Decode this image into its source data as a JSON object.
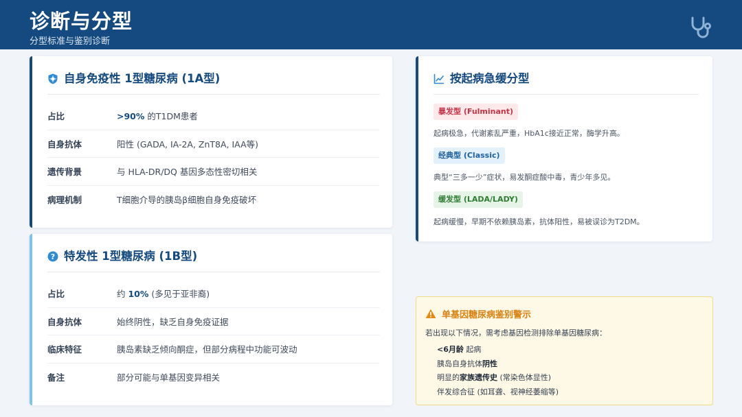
{
  "header": {
    "title": "诊断与分型",
    "subtitle": "分型标准与鉴别诊断"
  },
  "type1a": {
    "title": "自身免疫性 1型糖尿病 (1A型)",
    "rows": [
      {
        "key": "占比",
        "value_strong": ">90%",
        "value_rest": " 的T1DM患者"
      },
      {
        "key": "自身抗体",
        "value": "阳性 (GADA, IA-2A, ZnT8A, IAA等)"
      },
      {
        "key": "遗传背景",
        "value": "与 HLA-DR/DQ 基因多态性密切相关"
      },
      {
        "key": "病理机制",
        "value": "T细胞介导的胰岛β细胞自身免疫破坏"
      }
    ]
  },
  "type1b": {
    "title": "特发性 1型糖尿病 (1B型)",
    "rows": [
      {
        "key": "占比",
        "value_pre": "约 ",
        "value_strong": "10%",
        "value_rest": " (多见于亚非裔)"
      },
      {
        "key": "自身抗体",
        "value": "始终阴性，缺乏自身免疫证据"
      },
      {
        "key": "临床特征",
        "value": "胰岛素缺乏倾向酮症，但部分病程中功能可波动"
      },
      {
        "key": "备注",
        "value": "部分可能与单基因变异相关"
      }
    ]
  },
  "onset": {
    "title": "按起病急缓分型",
    "types": [
      {
        "tag": "暴发型 (Fulminant)",
        "desc": "起病极急，代谢紊乱严重，HbA1c接近正常，酶学升高。",
        "color": "#c63344"
      },
      {
        "tag": "经典型 (Classic)",
        "desc": "典型“三多一少”症状，易发酮症酸中毒，青少年多见。",
        "color": "#1d5f9f"
      },
      {
        "tag": "缓发型 (LADA/LADY)",
        "desc": "起病缓慢，早期不依赖胰岛素，抗体阳性，易被误诊为T2DM。",
        "color": "#2e7d32"
      }
    ]
  },
  "warning": {
    "title": "单基因糖尿病鉴别警示",
    "intro": "若出现以下情况，需考虑基因检测排除单基因糖尿病：",
    "items": [
      {
        "strong": "<6月龄",
        "rest": " 起病"
      },
      {
        "pre": "胰岛自身抗体",
        "strong": "阴性",
        "rest": ""
      },
      {
        "pre": "明显的",
        "strong": "家族遗传史",
        "rest": " (常染色体显性)"
      },
      {
        "pre": "伴发综合征 (如耳聋、视神经萎缩等)",
        "strong": "",
        "rest": ""
      }
    ]
  },
  "colors": {
    "brand": "#154a80",
    "accent_light": "#7cc4f0",
    "warning": "#d98211"
  },
  "icons": {
    "header": "stethoscope-icon",
    "type1a": "shield-virus-icon",
    "type1b": "question-circle-icon",
    "onset": "line-chart-icon",
    "warning": "warning-triangle-icon"
  }
}
